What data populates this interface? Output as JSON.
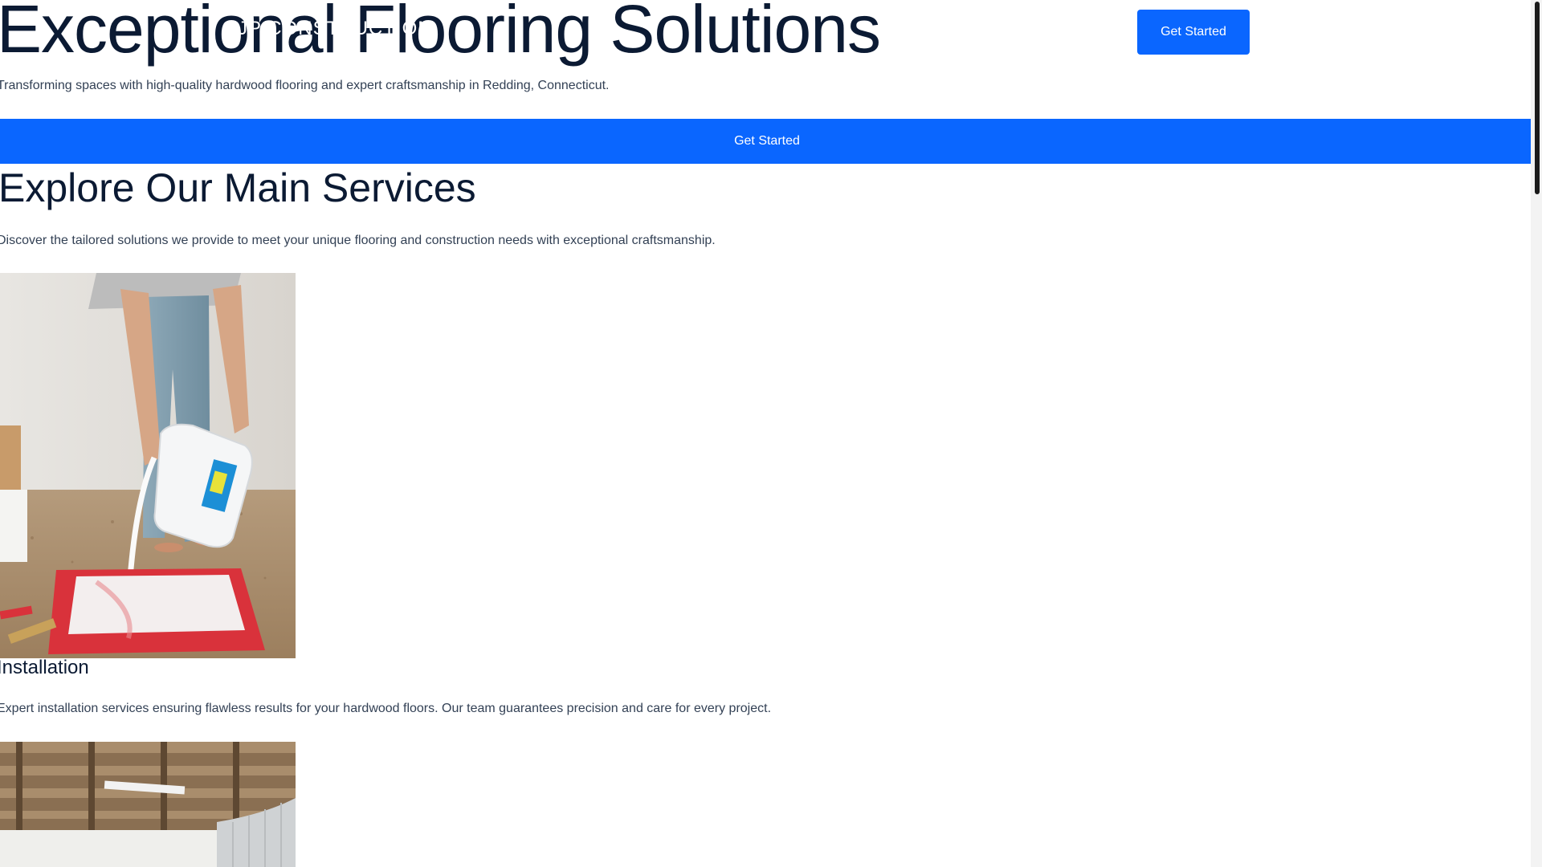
{
  "header": {
    "brand": "JP CONSTRUCTION",
    "cta_label": "Get Started"
  },
  "hero": {
    "title": "Exceptional Flooring Solutions",
    "subtitle": "Transforming spaces with high-quality hardwood flooring and expert craftsmanship in Redding, Connecticut.",
    "cta_label": "Get Started"
  },
  "services": {
    "title": "Explore Our Main Services",
    "subtitle": "Discover the tailored solutions we provide to meet your unique flooring and construction needs with exceptional craftsmanship.",
    "items": [
      {
        "title": "Installation",
        "description": "Expert installation services ensuring flawless results for your hardwood floors. Our team guarantees precision and care for every project."
      }
    ]
  },
  "colors": {
    "accent": "#0a66ff",
    "heading": "#0b1a33",
    "body_text": "#334155"
  }
}
